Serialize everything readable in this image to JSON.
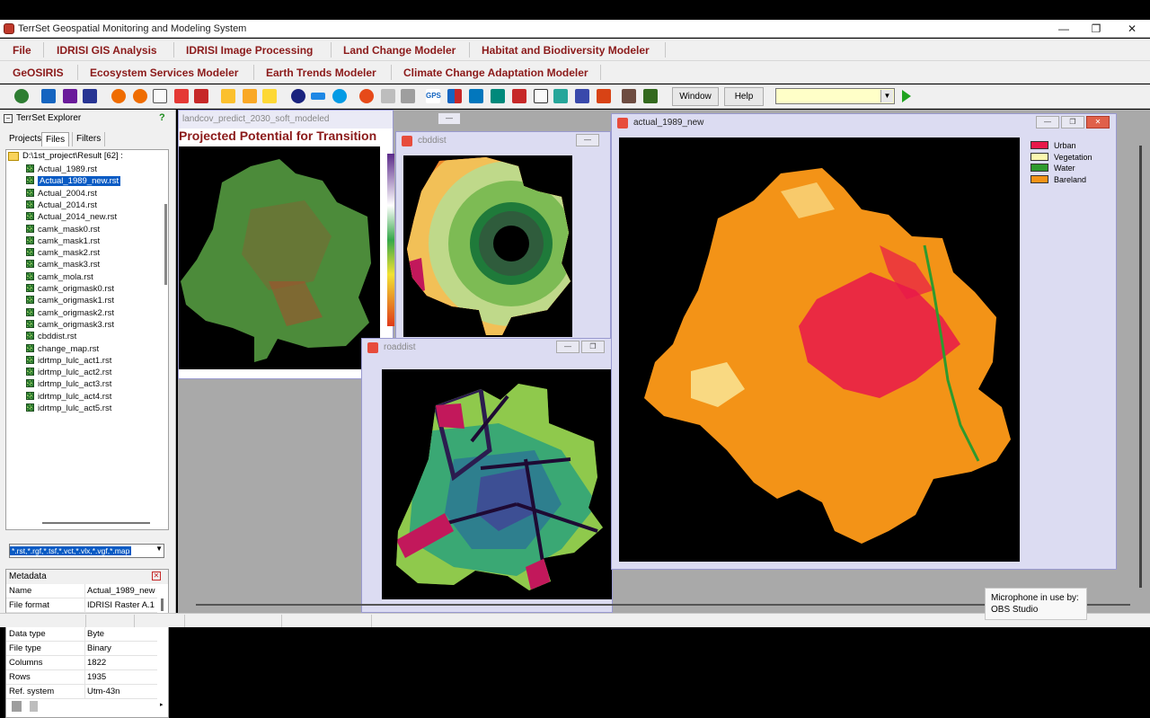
{
  "app": {
    "title": "TerrSet Geospatial Monitoring and Modeling System",
    "min": "—",
    "restore": "❐",
    "close": "✕"
  },
  "menu_row1": [
    "File",
    "IDRISI GIS Analysis",
    "IDRISI Image Processing",
    "Land Change Modeler",
    "Habitat and Biodiversity Modeler"
  ],
  "menu_row2": [
    "GeOSIRIS",
    "Ecosystem Services Modeler",
    "Earth Trends Modeler",
    "Climate Change Adaptation Modeler"
  ],
  "toolbar": {
    "window_label": "Window",
    "help_label": "Help",
    "combo_value": "",
    "gps_label": "GPS"
  },
  "explorer": {
    "title": "TerrSet Explorer",
    "help": "?",
    "tabs": [
      "Projects",
      "Files",
      "Filters"
    ],
    "root": "D:\\1st_project\\Result [62] :",
    "files": [
      "Actual_1989.rst",
      "Actual_1989_new.rst",
      "Actual_2004.rst",
      "Actual_2014.rst",
      "Actual_2014_new.rst",
      "camk_mask0.rst",
      "camk_mask1.rst",
      "camk_mask2.rst",
      "camk_mask3.rst",
      "camk_mola.rst",
      "camk_origmask0.rst",
      "camk_origmask1.rst",
      "camk_origmask2.rst",
      "camk_origmask3.rst",
      "cbddist.rst",
      "change_map.rst",
      "idrtmp_lulc_act1.rst",
      "idrtmp_lulc_act2.rst",
      "idrtmp_lulc_act3.rst",
      "idrtmp_lulc_act4.rst",
      "idrtmp_lulc_act5.rst"
    ],
    "selected_index": 1,
    "filter": "*.rst,*.rgf,*.tsf,*.vct,*.vlx,*.vgf,*.map",
    "metadata_title": "Metadata",
    "metadata": [
      {
        "k": "Name",
        "v": "Actual_1989_new"
      },
      {
        "k": "File format",
        "v": "IDRISI Raster A.1"
      },
      {
        "k": "File title",
        "v": ""
      },
      {
        "k": "Data type",
        "v": "Byte"
      },
      {
        "k": "File type",
        "v": "Binary"
      },
      {
        "k": "Columns",
        "v": "1822"
      },
      {
        "k": "Rows",
        "v": "1935"
      },
      {
        "k": "Ref. system",
        "v": "Utm-43n"
      }
    ]
  },
  "windows": {
    "landcov": {
      "title": "landcov_predict_2030_soft_modeled",
      "heading": "Projected Potential for Transition"
    },
    "cbddist": {
      "title": "cbddist"
    },
    "roaddist": {
      "title": "roaddist"
    },
    "actual": {
      "title": "actual_1989_new"
    }
  },
  "legend": [
    {
      "label": "Urban",
      "color": "#e8184a"
    },
    {
      "label": "Vegetation",
      "color": "#fbf7b0"
    },
    {
      "label": "Water",
      "color": "#2e9a2e"
    },
    {
      "label": "Bareland",
      "color": "#f39317"
    }
  ],
  "toast": {
    "line1": "Microphone in use by:",
    "line2": "OBS Studio"
  }
}
